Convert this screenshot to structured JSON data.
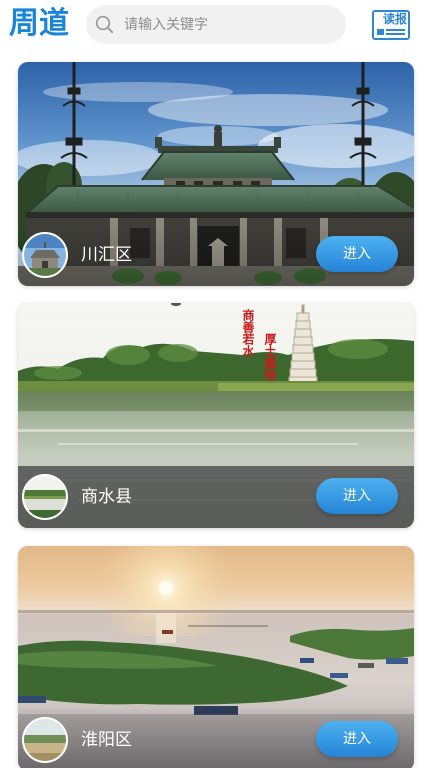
{
  "header": {
    "logo_text": "周道",
    "search_placeholder": "请输入关键字",
    "newspaper_label": "读报"
  },
  "icons": {
    "search": "search-icon",
    "newspaper": "newspaper-icon"
  },
  "colors": {
    "accent": "#1a85d6",
    "search_background": "#f1f1f1",
    "button_gradient_top": "#4db1f1",
    "button_gradient_bottom": "#2584d6",
    "caption_red": "#c61d1d"
  },
  "cards": [
    {
      "name": "川汇区",
      "button": "进入"
    },
    {
      "name": "商水县",
      "button": "进入",
      "image_text": [
        "商善若水",
        "厚土载物"
      ]
    },
    {
      "name": "淮阳区",
      "button": "进入"
    }
  ]
}
